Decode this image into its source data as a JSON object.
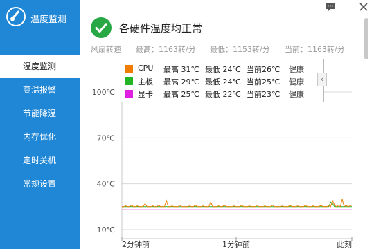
{
  "app": {
    "title": "温度监测",
    "logo_icon": "thermometer-icon"
  },
  "sidebar": {
    "items": [
      {
        "label": "温度监测",
        "active": true
      },
      {
        "label": "高温报警",
        "active": false
      },
      {
        "label": "节能降温",
        "active": false
      },
      {
        "label": "内存优化",
        "active": false
      },
      {
        "label": "定时关机",
        "active": false
      },
      {
        "label": "常规设置",
        "active": false
      }
    ]
  },
  "window": {
    "feedback_icon": "chat-icon",
    "close_icon": "close-icon"
  },
  "status": {
    "icon": "check-circle-icon",
    "headline": "各硬件温度均正常"
  },
  "fan": {
    "label": "风扇转速",
    "max": "最高：1163转/分",
    "min": "最低：1153转/分",
    "current": "当前：1163转/分"
  },
  "legend": {
    "toggle_icon": "chevron-left-icon",
    "rows": [
      {
        "name": "CPU",
        "max": "最高 31℃",
        "min": "最低 24℃",
        "current": "当前26℃",
        "status": "健康",
        "color": "#f07c00"
      },
      {
        "name": "主板",
        "max": "最高 29℃",
        "min": "最低 24℃",
        "current": "当前25℃",
        "status": "健康",
        "color": "#22b422"
      },
      {
        "name": "显卡",
        "max": "最高 25℃",
        "min": "最低 22℃",
        "current": "当前23℃",
        "status": "健康",
        "color": "#e020e0"
      }
    ]
  },
  "chart_data": {
    "type": "line",
    "y_ticks": [
      "100℃",
      "70℃",
      "40℃",
      "10℃"
    ],
    "y_tick_values": [
      100,
      70,
      40,
      10
    ],
    "x_labels": [
      "2分钟前",
      "1分钟前",
      "此刻"
    ],
    "ylim": [
      10,
      100
    ],
    "grid": true,
    "legend_placement": "top",
    "x_count": 120,
    "series": [
      {
        "name": "CPU",
        "color": "#f07c00",
        "values": [
          25,
          25,
          25.5,
          25,
          25,
          26,
          25,
          25,
          25.5,
          25,
          25,
          25,
          27,
          25,
          25,
          25,
          25.5,
          25,
          25,
          26,
          25,
          25,
          25,
          29,
          25,
          25,
          25.5,
          25,
          25,
          25,
          26,
          25,
          25,
          25,
          25,
          25.5,
          25,
          25,
          26,
          25,
          25,
          25,
          25.5,
          25,
          25,
          25,
          28,
          25,
          25,
          25,
          25.5,
          25,
          25,
          26,
          25,
          25,
          25,
          25,
          25.5,
          25,
          25,
          25,
          26,
          25,
          25,
          25,
          25.5,
          25,
          25,
          25,
          26,
          25,
          25,
          25,
          25.5,
          25,
          25,
          25,
          26,
          25,
          25,
          25,
          25,
          25.5,
          25,
          25,
          25,
          26,
          25,
          25,
          25,
          25.5,
          25,
          25,
          25,
          26,
          25,
          25,
          25,
          25.5,
          25,
          25,
          25,
          26,
          25,
          25,
          25,
          25.5,
          25,
          29,
          26,
          25,
          26,
          25,
          30,
          25,
          26,
          25,
          25.5,
          26
        ]
      },
      {
        "name": "主板",
        "color": "#22b422",
        "values": [
          25,
          25,
          25,
          25,
          25,
          25,
          25,
          25,
          25,
          25,
          25,
          25,
          25,
          25,
          25,
          25,
          25,
          25,
          25,
          25,
          25,
          25,
          25,
          25,
          25,
          25,
          25,
          25,
          25,
          25,
          25,
          25,
          25,
          25,
          25,
          25,
          25,
          25,
          25,
          25,
          25,
          25,
          25,
          25,
          25,
          25,
          25,
          25,
          25,
          25,
          25,
          25,
          25,
          25,
          25,
          25,
          25,
          25,
          25,
          25,
          25,
          25,
          25,
          25,
          25,
          25,
          25,
          25,
          25,
          25,
          25,
          25,
          25,
          25,
          25,
          25,
          25,
          25,
          25,
          25,
          25,
          25,
          25,
          25,
          25,
          25,
          25,
          25,
          25,
          25,
          25,
          25,
          25,
          25,
          25,
          25,
          25,
          25,
          25,
          25,
          25,
          25,
          25,
          25,
          25,
          25,
          25,
          25,
          28,
          27,
          25,
          25,
          25,
          25,
          25,
          25,
          25,
          25,
          25,
          25
        ]
      },
      {
        "name": "显卡",
        "color": "#e020e0",
        "values": [
          23,
          23,
          23,
          23,
          23,
          23,
          23,
          23,
          23,
          23,
          23,
          23,
          23,
          23,
          23,
          23,
          23,
          23,
          23,
          23,
          23,
          23,
          23,
          23,
          23,
          23,
          23,
          23,
          23,
          23,
          23,
          23,
          23,
          23,
          23,
          23,
          23,
          23,
          23,
          23,
          23,
          23,
          23,
          23,
          23,
          23,
          23,
          23,
          23,
          23,
          23,
          23,
          23,
          23,
          23,
          23,
          23,
          23,
          23,
          23,
          23,
          23,
          23,
          23,
          23,
          23,
          23,
          23,
          23,
          23,
          23,
          23,
          23,
          23,
          23,
          23,
          23,
          23,
          23,
          23,
          23,
          23,
          23,
          23,
          23,
          23,
          23,
          23,
          23,
          23,
          23,
          23,
          23,
          23,
          23,
          23,
          23,
          23,
          23,
          23,
          23,
          23,
          23,
          23,
          23,
          23,
          23,
          23,
          23,
          23,
          23,
          23,
          23,
          23,
          23,
          23,
          23,
          23,
          23,
          23
        ]
      }
    ]
  }
}
